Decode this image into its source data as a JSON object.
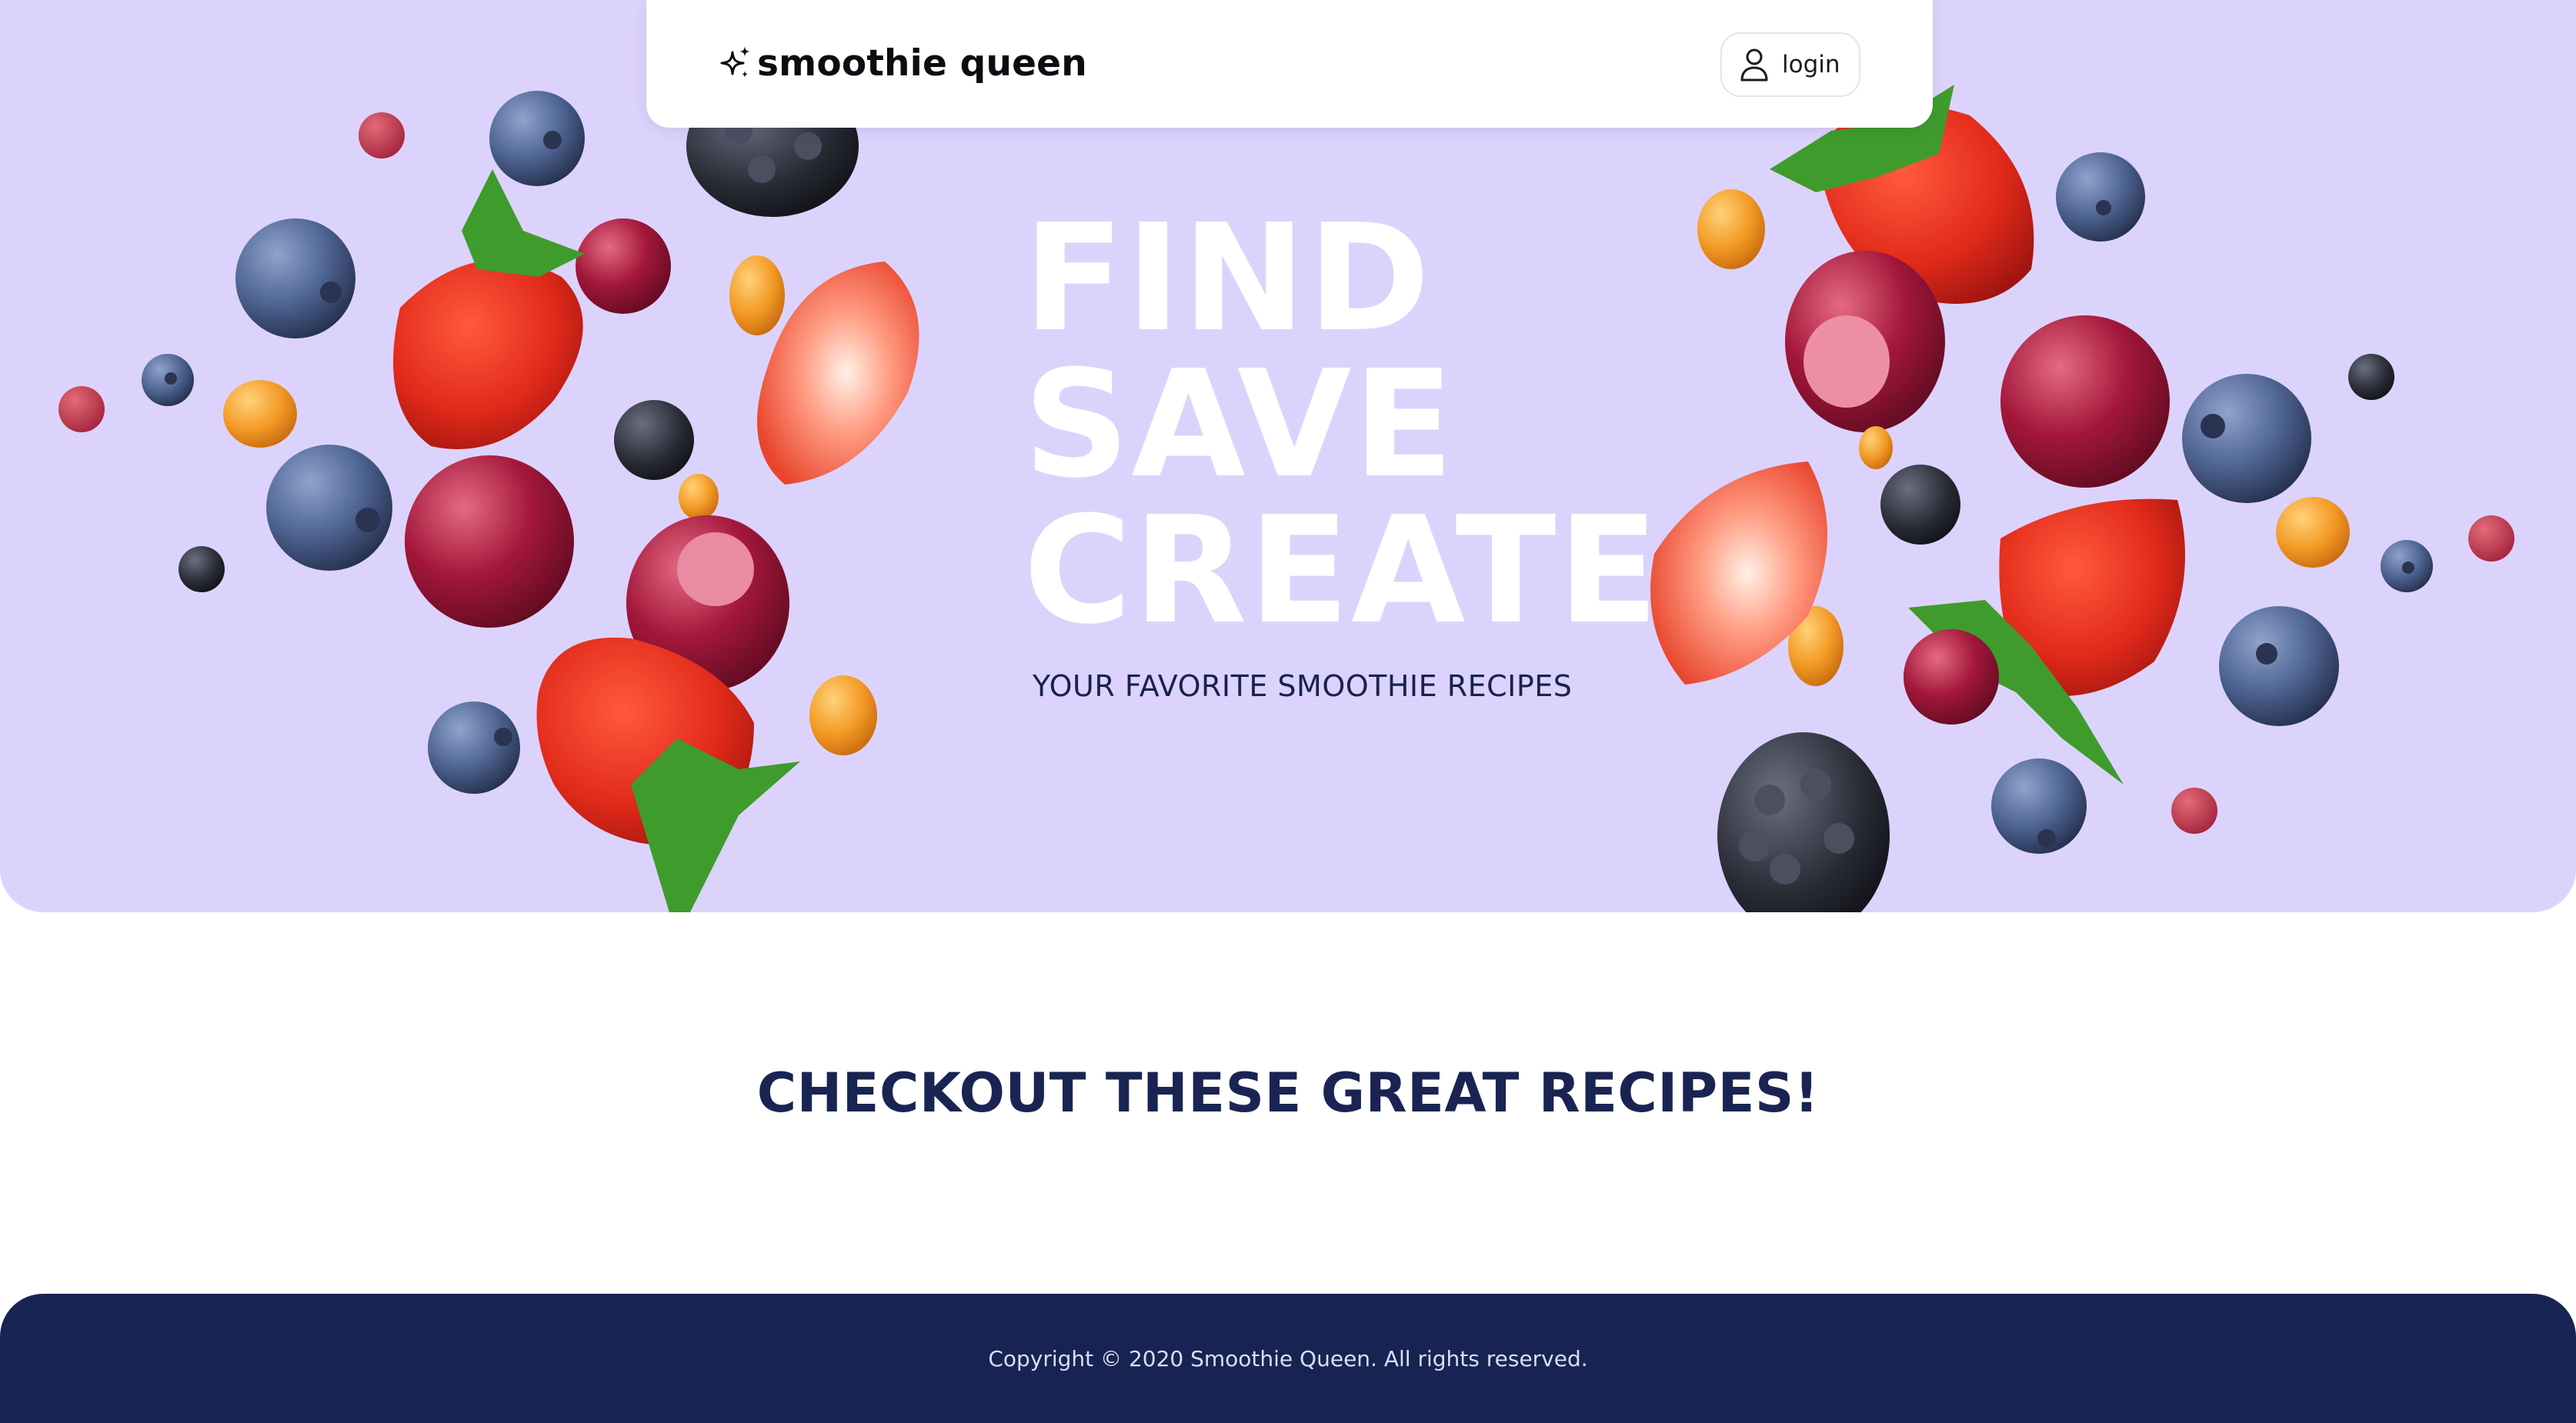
{
  "navbar": {
    "brand_name": "smoothie queen",
    "brand_icon": "sparkles-icon",
    "login_label": "login",
    "login_icon": "user-icon"
  },
  "hero": {
    "headline_lines": [
      "FIND",
      "SAVE",
      "CREATE"
    ],
    "subheading": "YOUR FAVORITE SMOOTHIE RECIPES"
  },
  "recipes": {
    "title": "CHECKOUT THESE GREAT RECIPES!"
  },
  "footer": {
    "copyright": "Copyright © 2020 Smoothie Queen. All rights reserved."
  },
  "colors": {
    "hero_background": "#dcd3fd",
    "navy": "#172352",
    "heading_text": "#1a2453",
    "headline_text": "#ffffff"
  }
}
